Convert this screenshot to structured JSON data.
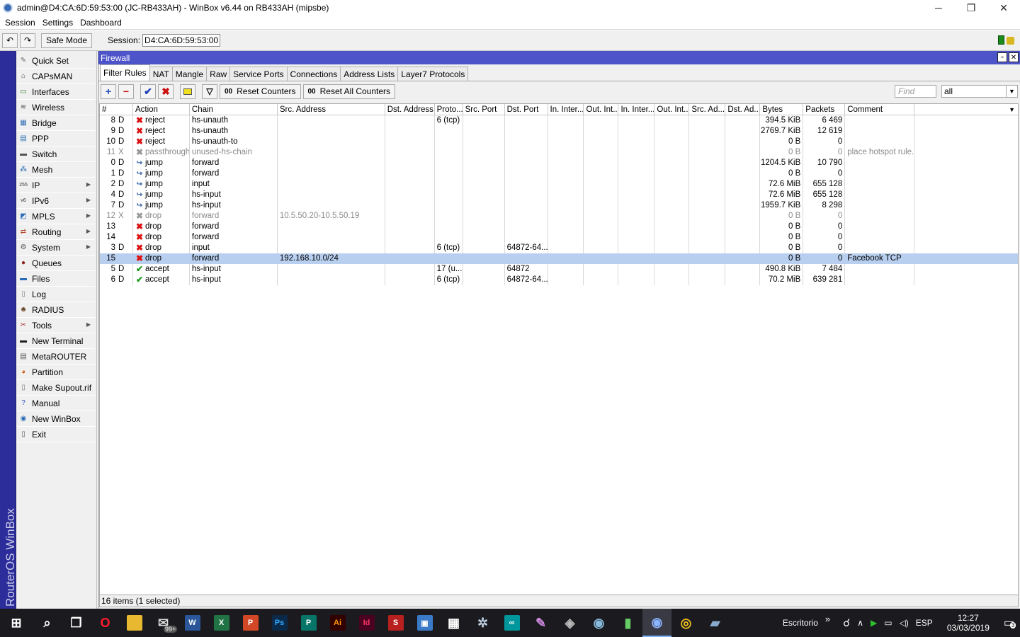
{
  "window": {
    "title": "admin@D4:CA:6D:59:53:00 (JC-RB433AH) - WinBox v6.44 on RB433AH (mipsbe)",
    "minimize": "─",
    "maximize": "❐",
    "close": "✕"
  },
  "menu": [
    "Session",
    "Settings",
    "Dashboard"
  ],
  "toolbar": {
    "undo": "↶",
    "redo": "↷",
    "safe_mode": "Safe Mode",
    "session_label": "Session:",
    "session_value": "D4:CA:6D:59:53:00"
  },
  "brand_vertical": "RouterOS WinBox",
  "sidebar": [
    {
      "label": "Quick Set",
      "icon": "quick-set-icon",
      "glyph": "✎",
      "color": "#6a6a6a",
      "arrow": false
    },
    {
      "label": "CAPsMAN",
      "icon": "capsman-icon",
      "glyph": "⌂",
      "color": "#555",
      "arrow": false
    },
    {
      "label": "Interfaces",
      "icon": "interfaces-icon",
      "glyph": "▭",
      "color": "#2f7a2f",
      "arrow": false
    },
    {
      "label": "Wireless",
      "icon": "wireless-icon",
      "glyph": "≋",
      "color": "#555",
      "arrow": false
    },
    {
      "label": "Bridge",
      "icon": "bridge-icon",
      "glyph": "▦",
      "color": "#2a6bb5",
      "arrow": false
    },
    {
      "label": "PPP",
      "icon": "ppp-icon",
      "glyph": "▤",
      "color": "#2a6bb5",
      "arrow": false
    },
    {
      "label": "Switch",
      "icon": "switch-icon",
      "glyph": "▬",
      "color": "#555",
      "arrow": false
    },
    {
      "label": "Mesh",
      "icon": "mesh-icon",
      "glyph": "⁂",
      "color": "#2a6bb5",
      "arrow": false
    },
    {
      "label": "IP",
      "icon": "ip-icon",
      "glyph": "255",
      "color": "#333",
      "arrow": true
    },
    {
      "label": "IPv6",
      "icon": "ipv6-icon",
      "glyph": "v6",
      "color": "#333",
      "arrow": true
    },
    {
      "label": "MPLS",
      "icon": "mpls-icon",
      "glyph": "◩",
      "color": "#2a6bb5",
      "arrow": true
    },
    {
      "label": "Routing",
      "icon": "routing-icon",
      "glyph": "⇄",
      "color": "#b5462a",
      "arrow": true
    },
    {
      "label": "System",
      "icon": "system-icon",
      "glyph": "⚙",
      "color": "#555",
      "arrow": true
    },
    {
      "label": "Queues",
      "icon": "queues-icon",
      "glyph": "●",
      "color": "#8a2020",
      "arrow": false
    },
    {
      "label": "Files",
      "icon": "files-icon",
      "glyph": "▬",
      "color": "#2a6bb5",
      "arrow": false
    },
    {
      "label": "Log",
      "icon": "log-icon",
      "glyph": "▯",
      "color": "#777",
      "arrow": false
    },
    {
      "label": "RADIUS",
      "icon": "radius-icon",
      "glyph": "☻",
      "color": "#6a4a2a",
      "arrow": false
    },
    {
      "label": "Tools",
      "icon": "tools-icon",
      "glyph": "✂",
      "color": "#a33",
      "arrow": true
    },
    {
      "label": "New Terminal",
      "icon": "terminal-icon",
      "glyph": "▬",
      "color": "#222",
      "arrow": false
    },
    {
      "label": "MetaROUTER",
      "icon": "metarouter-icon",
      "glyph": "▤",
      "color": "#555",
      "arrow": false
    },
    {
      "label": "Partition",
      "icon": "partition-icon",
      "glyph": "◕",
      "color": "#d2601a",
      "arrow": false
    },
    {
      "label": "Make Supout.rif",
      "icon": "supout-icon",
      "glyph": "▯",
      "color": "#777",
      "arrow": false
    },
    {
      "label": "Manual",
      "icon": "manual-icon",
      "glyph": "?",
      "color": "#2a4ab5",
      "arrow": false
    },
    {
      "label": "New WinBox",
      "icon": "winbox-icon",
      "glyph": "◉",
      "color": "#2a6bb5",
      "arrow": false
    },
    {
      "label": "Exit",
      "icon": "exit-icon",
      "glyph": "▯",
      "color": "#555",
      "arrow": false
    }
  ],
  "firewall": {
    "title": "Firewall",
    "tabs": [
      "Filter Rules",
      "NAT",
      "Mangle",
      "Raw",
      "Service Ports",
      "Connections",
      "Address Lists",
      "Layer7 Protocols"
    ],
    "active_tab": 0,
    "buttons": {
      "reset_counters": "Reset Counters",
      "reset_all_counters": "Reset All Counters",
      "counter_prefix": "00"
    },
    "find_placeholder": "Find",
    "filter_value": "all",
    "columns": [
      "#",
      "Action",
      "Chain",
      "Src. Address",
      "Dst. Address",
      "Proto...",
      "Src. Port",
      "Dst. Port",
      "In. Inter...",
      "Out. Int...",
      "In. Inter...",
      "Out. Int...",
      "Src. Ad...",
      "Dst. Ad...",
      "Bytes",
      "Packets",
      "Comment"
    ],
    "rows": [
      {
        "num": "8",
        "flag": "D",
        "action": "reject",
        "chain": "hs-unauth",
        "src": "",
        "proto": "6 (tcp)",
        "dport": "",
        "bytes": "394.5 KiB",
        "packets": "6 469",
        "comment": "",
        "state": ""
      },
      {
        "num": "9",
        "flag": "D",
        "action": "reject",
        "chain": "hs-unauth",
        "src": "",
        "proto": "",
        "dport": "",
        "bytes": "2769.7 KiB",
        "packets": "12 619",
        "comment": "",
        "state": ""
      },
      {
        "num": "10",
        "flag": "D",
        "action": "reject",
        "chain": "hs-unauth-to",
        "src": "",
        "proto": "",
        "dport": "",
        "bytes": "0 B",
        "packets": "0",
        "comment": "",
        "state": ""
      },
      {
        "num": "11",
        "flag": "X",
        "action": "passthrough",
        "chain": "unused-hs-chain",
        "src": "",
        "proto": "",
        "dport": "",
        "bytes": "0 B",
        "packets": "0",
        "comment": "place hotspot rule...",
        "state": "disabled"
      },
      {
        "num": "0",
        "flag": "D",
        "action": "jump",
        "chain": "forward",
        "src": "",
        "proto": "",
        "dport": "",
        "bytes": "1204.5 KiB",
        "packets": "10 790",
        "comment": "",
        "state": ""
      },
      {
        "num": "1",
        "flag": "D",
        "action": "jump",
        "chain": "forward",
        "src": "",
        "proto": "",
        "dport": "",
        "bytes": "0 B",
        "packets": "0",
        "comment": "",
        "state": ""
      },
      {
        "num": "2",
        "flag": "D",
        "action": "jump",
        "chain": "input",
        "src": "",
        "proto": "",
        "dport": "",
        "bytes": "72.6 MiB",
        "packets": "655 128",
        "comment": "",
        "state": ""
      },
      {
        "num": "4",
        "flag": "D",
        "action": "jump",
        "chain": "hs-input",
        "src": "",
        "proto": "",
        "dport": "",
        "bytes": "72.6 MiB",
        "packets": "655 128",
        "comment": "",
        "state": ""
      },
      {
        "num": "7",
        "flag": "D",
        "action": "jump",
        "chain": "hs-input",
        "src": "",
        "proto": "",
        "dport": "",
        "bytes": "1959.7 KiB",
        "packets": "8 298",
        "comment": "",
        "state": ""
      },
      {
        "num": "12",
        "flag": "X",
        "action": "drop",
        "chain": "forward",
        "src": "10.5.50.20-10.5.50.19",
        "proto": "",
        "dport": "",
        "bytes": "0 B",
        "packets": "0",
        "comment": "",
        "state": "disabled"
      },
      {
        "num": "13",
        "flag": "",
        "action": "drop",
        "chain": "forward",
        "src": "",
        "proto": "",
        "dport": "",
        "bytes": "0 B",
        "packets": "0",
        "comment": "",
        "state": ""
      },
      {
        "num": "14",
        "flag": "",
        "action": "drop",
        "chain": "forward",
        "src": "",
        "proto": "",
        "dport": "",
        "bytes": "0 B",
        "packets": "0",
        "comment": "",
        "state": ""
      },
      {
        "num": "3",
        "flag": "D",
        "action": "drop",
        "chain": "input",
        "src": "",
        "proto": "6 (tcp)",
        "dport": "64872-64...",
        "bytes": "0 B",
        "packets": "0",
        "comment": "",
        "state": ""
      },
      {
        "num": "15",
        "flag": "",
        "action": "drop",
        "chain": "forward",
        "src": "192.168.10.0/24",
        "proto": "",
        "dport": "",
        "bytes": "0 B",
        "packets": "0",
        "comment": "Facebook TCP",
        "state": "selected"
      },
      {
        "num": "5",
        "flag": "D",
        "action": "accept",
        "chain": "hs-input",
        "src": "",
        "proto": "17 (u...",
        "dport": "64872",
        "bytes": "490.8 KiB",
        "packets": "7 484",
        "comment": "",
        "state": ""
      },
      {
        "num": "6",
        "flag": "D",
        "action": "accept",
        "chain": "hs-input",
        "src": "",
        "proto": "6 (tcp)",
        "dport": "64872-64...",
        "bytes": "70.2 MiB",
        "packets": "639 281",
        "comment": "",
        "state": ""
      }
    ],
    "status": "16 items (1 selected)"
  },
  "taskbar": {
    "apps": [
      {
        "name": "start-icon",
        "glyph": "⊞",
        "bg": "transparent",
        "fg": "#fff"
      },
      {
        "name": "search-icon",
        "glyph": "⌕",
        "bg": "transparent",
        "fg": "#fff"
      },
      {
        "name": "task-view-icon",
        "glyph": "❐",
        "bg": "transparent",
        "fg": "#fff"
      },
      {
        "name": "opera-icon",
        "glyph": "O",
        "bg": "transparent",
        "fg": "#ff1b2d"
      },
      {
        "name": "file-explorer-icon",
        "glyph": "▆",
        "bg": "#e8b830",
        "fg": "#e8b830"
      },
      {
        "name": "mail-icon",
        "glyph": "✉",
        "bg": "transparent",
        "fg": "#ddd"
      },
      {
        "name": "word-icon",
        "glyph": "W",
        "bg": "#2b579a",
        "fg": "#fff"
      },
      {
        "name": "excel-icon",
        "glyph": "X",
        "bg": "#217346",
        "fg": "#fff"
      },
      {
        "name": "powerpoint-icon",
        "glyph": "P",
        "bg": "#d24726",
        "fg": "#fff"
      },
      {
        "name": "photoshop-icon",
        "glyph": "Ps",
        "bg": "#0b2a4a",
        "fg": "#31a8ff"
      },
      {
        "name": "publisher-icon",
        "glyph": "P",
        "bg": "#077568",
        "fg": "#fff"
      },
      {
        "name": "illustrator-icon",
        "glyph": "Ai",
        "bg": "#330000",
        "fg": "#ff9a00"
      },
      {
        "name": "indesign-icon",
        "glyph": "Id",
        "bg": "#49021f",
        "fg": "#ff3366"
      },
      {
        "name": "app-s-icon",
        "glyph": "S",
        "bg": "#b82020",
        "fg": "#fff"
      },
      {
        "name": "app-monitor-icon",
        "glyph": "▣",
        "bg": "#3a7ac9",
        "fg": "#fff"
      },
      {
        "name": "calendar-icon",
        "glyph": "▦",
        "bg": "transparent",
        "fg": "#fff"
      },
      {
        "name": "network-tool-icon",
        "glyph": "✲",
        "bg": "transparent",
        "fg": "#bcd"
      },
      {
        "name": "arduino-icon",
        "glyph": "∞",
        "bg": "#00979c",
        "fg": "#fff"
      },
      {
        "name": "app-pen-icon",
        "glyph": "✎",
        "bg": "transparent",
        "fg": "#c8d"
      },
      {
        "name": "app-robot-icon",
        "glyph": "◈",
        "bg": "transparent",
        "fg": "#bbb"
      },
      {
        "name": "eye-icon",
        "glyph": "◉",
        "bg": "transparent",
        "fg": "#8bd"
      },
      {
        "name": "battery-app-icon",
        "glyph": "▮",
        "bg": "transparent",
        "fg": "#6c6"
      },
      {
        "name": "winbox-taskbar-icon",
        "glyph": "◉",
        "bg": "transparent",
        "fg": "#8ab4ff"
      },
      {
        "name": "chrome-icon",
        "glyph": "◎",
        "bg": "transparent",
        "fg": "#f0c020"
      },
      {
        "name": "notepad-icon",
        "glyph": "▰",
        "bg": "transparent",
        "fg": "#8ac"
      }
    ],
    "badge": "99+",
    "desktop_label": "Escritorio",
    "more": "»",
    "language": "ESP",
    "time": "12:27",
    "date": "03/03/2019",
    "notifications": "3"
  }
}
